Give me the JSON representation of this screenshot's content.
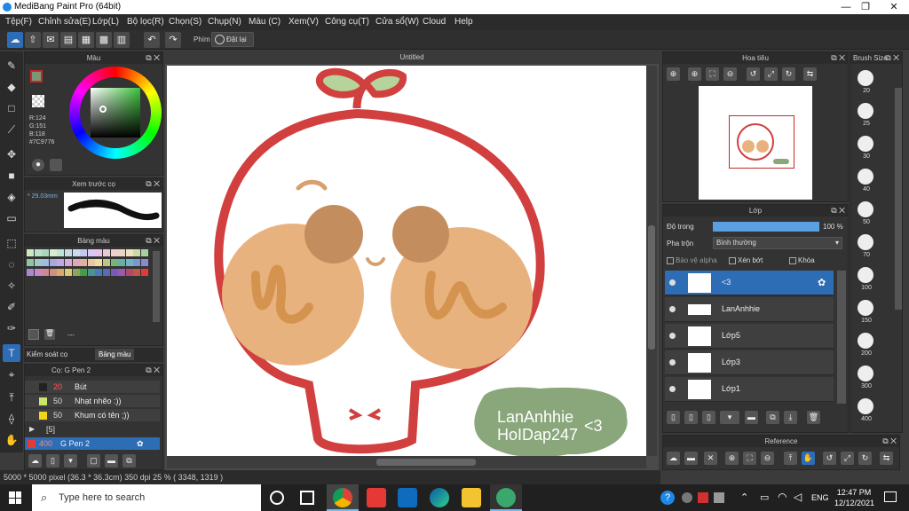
{
  "window": {
    "title": "MediBang Paint Pro (64bit)",
    "minimize": "—",
    "maximize": "❐",
    "close": "✕"
  },
  "menu": [
    "Tệp(F)",
    "Chỉnh sửa(E)",
    "Lớp(L)",
    "Bộ lọc(R)",
    "Chọn(S)",
    "Chụp(N)",
    "Màu (C)",
    "Xem(V)",
    "Công cụ(T)",
    "Cửa sổ(W)",
    "Cloud",
    "Help"
  ],
  "toolbar": {
    "shortcut_label": "Phím",
    "reset_label": "Đặt lại"
  },
  "color_panel": {
    "title": "Màu",
    "r": "R:124",
    "g": "G:151",
    "b": "B:118",
    "hex": "#7C9776",
    "fg_color": "#c62828",
    "bg_color": "#ffffff"
  },
  "preview_panel": {
    "title": "Xem trước cọ",
    "size": "* 29.03mm"
  },
  "palette_panel": {
    "title": "Bảng màu",
    "footer": "---"
  },
  "control_tabs": {
    "brush_control": "Kiểm soát cọ",
    "palette": "Bảng màu"
  },
  "brush_panel": {
    "title": "Cọ: G Pen 2",
    "rows": [
      {
        "size": "20",
        "name": "Bút",
        "color": "#222222",
        "size_color": "#ff5a5a"
      },
      {
        "size": "50",
        "name": "Nhạt nhẽo :))",
        "color": "#c8e66b",
        "size_color": "#dddddd"
      },
      {
        "size": "50",
        "name": "Khum có tên ;))",
        "color": "#f5d31a",
        "size_color": "#dddddd"
      }
    ],
    "group": "[5]",
    "selected": {
      "size": "400",
      "name": "G Pen 2",
      "color": "#e53935"
    }
  },
  "document": {
    "tab": "Untitled",
    "signature_line1": "LanAnhhie",
    "signature_line2": "HoIDap247",
    "signature_heart": "<3"
  },
  "navigator": {
    "title": "Hoa tiêu"
  },
  "layers_panel": {
    "title": "Lớp",
    "opacity_label": "Độ trong",
    "opacity_value": "100 %",
    "opacity_fraction": 1.0,
    "blend_label": "Pha trộn",
    "blend_value": "Bình thường",
    "protect_alpha": "Bảo vệ alpha",
    "clip": "Xén bớt",
    "lock": "Khóa",
    "layers": [
      {
        "name": "<3",
        "selected": true
      },
      {
        "name": "LanAnhhie",
        "selected": false
      },
      {
        "name": "Lớp5",
        "selected": false
      },
      {
        "name": "Lớp3",
        "selected": false
      },
      {
        "name": "Lớp1",
        "selected": false
      }
    ]
  },
  "reference_panel": {
    "title": "Reference"
  },
  "brush_size_panel": {
    "title": "Brush Size",
    "sizes": [
      "20",
      "25",
      "30",
      "40",
      "50",
      "70",
      "100",
      "150",
      "200",
      "300",
      "400"
    ]
  },
  "status": {
    "text": "5000 * 5000 pixel   (36.3 * 36.3cm)   350 dpi   25 %   ( 3348, 1319 )"
  },
  "taskbar": {
    "search_placeholder": "Type here to search",
    "time": "12:47 PM",
    "date": "12/12/2021",
    "lang": "ENG"
  }
}
